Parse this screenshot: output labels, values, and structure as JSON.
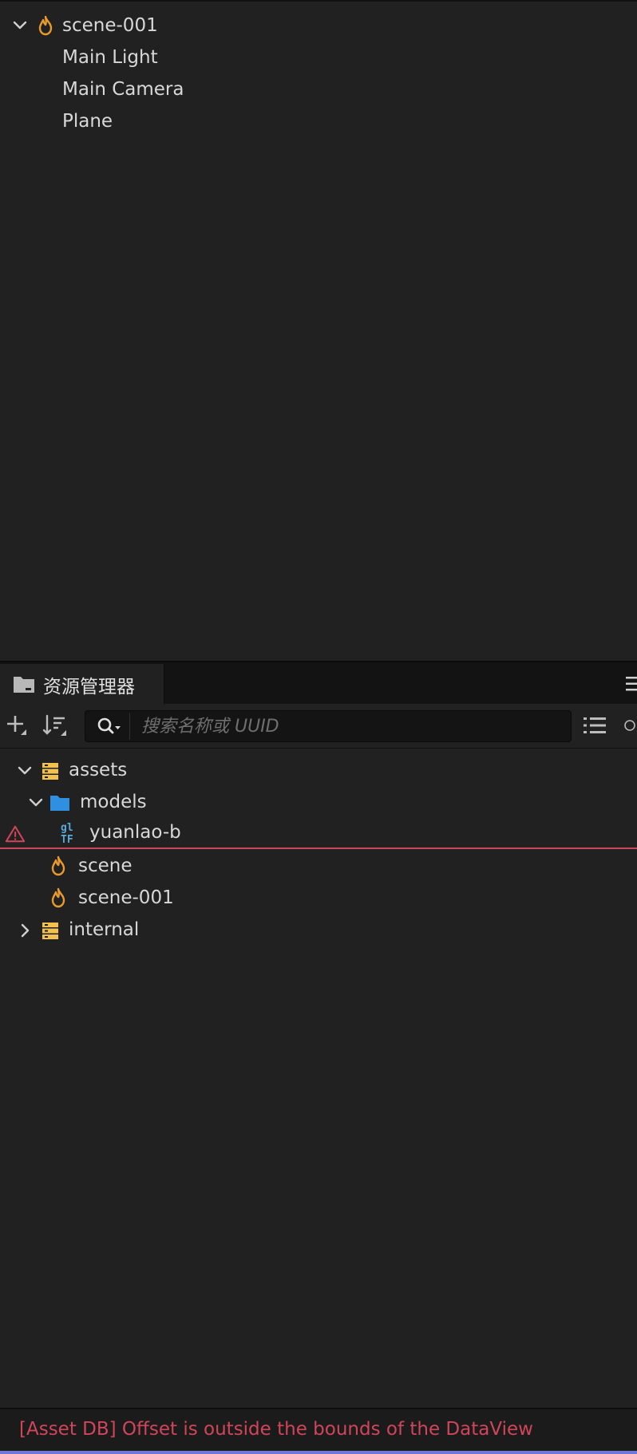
{
  "hierarchy": {
    "root": {
      "label": "scene-001",
      "icon": "scene-flame-icon",
      "expanded": true
    },
    "children": [
      {
        "label": "Main Light"
      },
      {
        "label": "Main Camera"
      },
      {
        "label": "Plane"
      }
    ]
  },
  "assets_panel": {
    "tab_label": "资源管理器",
    "tab_icon": "folder-icon",
    "toolbar": {
      "search_placeholder": "搜索名称或 UUID"
    },
    "tree": [
      {
        "label": "assets",
        "icon": "database-icon",
        "expanded": true
      },
      {
        "label": "models",
        "icon": "folder-icon",
        "expanded": true
      },
      {
        "label": "yuanlao-b",
        "icon": "gltf-icon",
        "status": "warning"
      },
      {
        "label": "scene",
        "icon": "scene-flame-icon"
      },
      {
        "label": "scene-001",
        "icon": "scene-flame-icon"
      },
      {
        "label": "internal",
        "icon": "database-icon",
        "expanded": false
      }
    ]
  },
  "status_bar": {
    "message": "[Asset DB] Offset is outside the bounds of the DataView"
  },
  "colors": {
    "background": "#212121",
    "scene_icon": "#e99a2e",
    "database_icon": "#f2c14e",
    "folder_icon": "#2f8fe0",
    "gltf_icon": "#5aa9d8",
    "error": "#d0455a"
  }
}
